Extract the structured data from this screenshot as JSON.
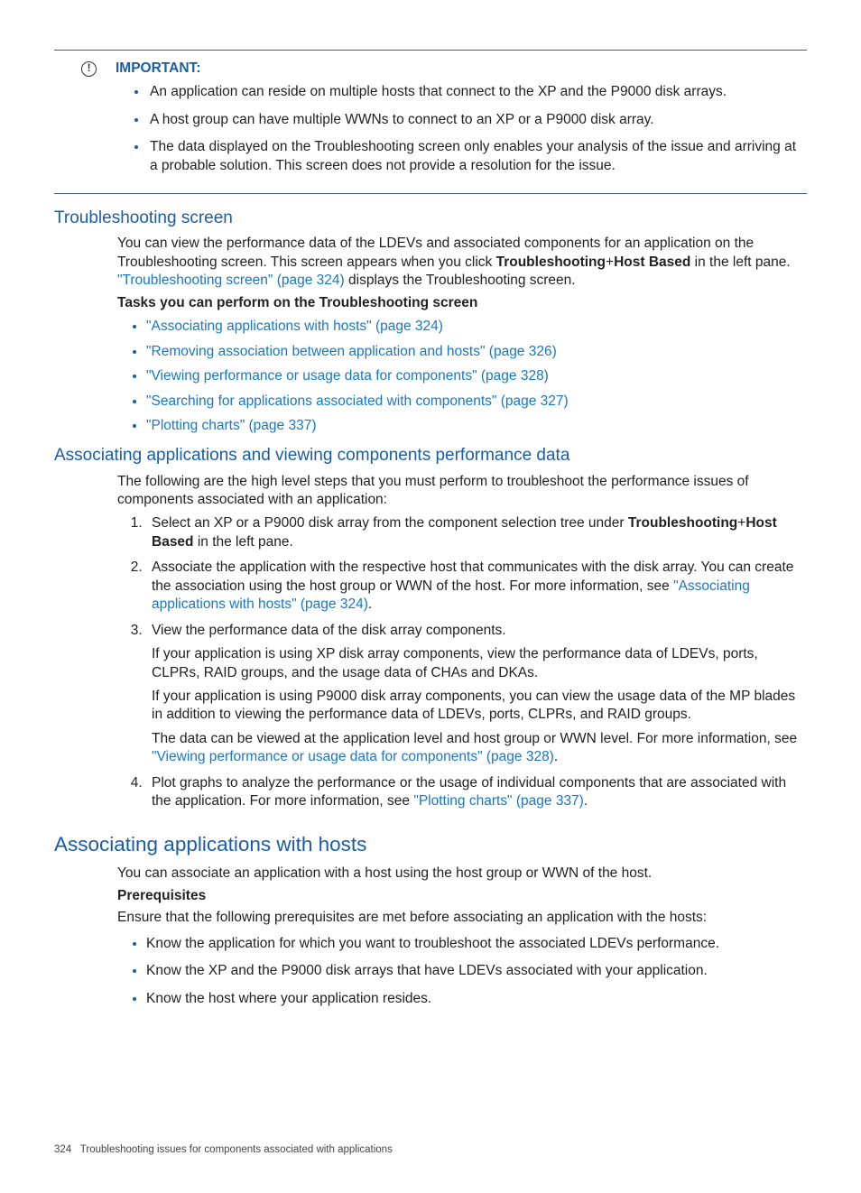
{
  "important": {
    "label": "IMPORTANT:",
    "items": [
      "An application can reside on multiple hosts that connect to the XP and the P9000 disk arrays.",
      "A host group can have multiple WWNs to connect to an XP or a P9000 disk array.",
      "The data displayed on the Troubleshooting screen only enables your analysis of the issue and arriving at a probable solution. This screen does not provide a resolution for the issue."
    ]
  },
  "s1": {
    "heading": "Troubleshooting screen",
    "p1a": "You can view the performance data of the LDEVs and associated components for an application on the Troubleshooting screen. This screen appears when you click ",
    "p1b": "Troubleshooting",
    "p1c": "+",
    "p1d": "Host Based",
    "p1e": " in the left pane. ",
    "link1": "\"Troubleshooting screen\" (page 324)",
    "p1f": " displays the Troubleshooting screen.",
    "tasks_heading": "Tasks you can perform on the Troubleshooting screen",
    "tasks": [
      "\"Associating applications with hosts\" (page 324)",
      "\"Removing association between application and hosts\" (page 326)",
      "\"Viewing performance or usage data for components\" (page 328)",
      "\"Searching for applications associated with components\" (page 327)",
      "\"Plotting charts\" (page 337)"
    ]
  },
  "s2": {
    "heading": "Associating applications and viewing components performance data",
    "intro": "The following are the high level steps that you must perform to troubleshoot the performance issues of components associated with an application:",
    "step1a": "Select an XP or a P9000 disk array from the component selection tree under ",
    "step1b": "Troubleshooting",
    "step1c": "+",
    "step1d": "Host Based",
    "step1e": " in the left pane.",
    "step2a": "Associate the application with the respective host that communicates with the disk array. You can create the association using the host group or WWN of the host. For more information, see ",
    "step2link": "\"Associating applications with hosts\" (page 324)",
    "step2b": ".",
    "step3a": "View the performance data of the disk array components.",
    "step3b": "If your application is using XP disk array components, view the performance data of LDEVs, ports, CLPRs, RAID groups, and the usage data of CHAs and DKAs.",
    "step3c": "If your application is using P9000 disk array components, you can view the usage data of the MP blades in addition to viewing the performance data of LDEVs, ports, CLPRs, and RAID groups.",
    "step3d": "The data can be viewed at the application level and host group or WWN level. For more information, see ",
    "step3link": "\"Viewing performance or usage data for components\" (page 328)",
    "step3e": ".",
    "step4a": "Plot graphs to analyze the performance or the usage of individual components that are associated with the application. For more information, see ",
    "step4link": "\"Plotting charts\" (page 337)",
    "step4b": "."
  },
  "s3": {
    "heading": "Associating applications with hosts",
    "intro": "You can associate an application with a host using the host group or WWN of the host.",
    "prereq_heading": "Prerequisites",
    "prereq_intro": "Ensure that the following prerequisites are met before associating an application with the hosts:",
    "prereqs": [
      "Know the application for which you want to troubleshoot the associated LDEVs performance.",
      "Know the XP and the P9000 disk arrays that have LDEVs associated with your application.",
      "Know the host where your application resides."
    ]
  },
  "footer": {
    "page": "324",
    "title": "Troubleshooting issues for components associated with applications"
  }
}
